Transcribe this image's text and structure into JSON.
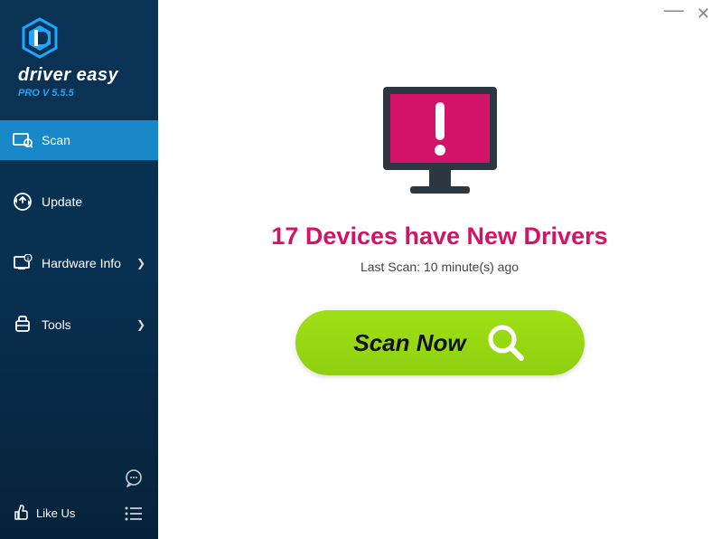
{
  "brand": {
    "name": "driver easy",
    "version": "PRO V 5.5.5"
  },
  "nav": {
    "scan": "Scan",
    "update": "Update",
    "hardware": "Hardware Info",
    "tools": "Tools"
  },
  "footer": {
    "likeus": "Like Us"
  },
  "main": {
    "headline": "17 Devices have New Drivers",
    "subline": "Last Scan: 10 minute(s) ago",
    "scan_button": "Scan Now"
  }
}
